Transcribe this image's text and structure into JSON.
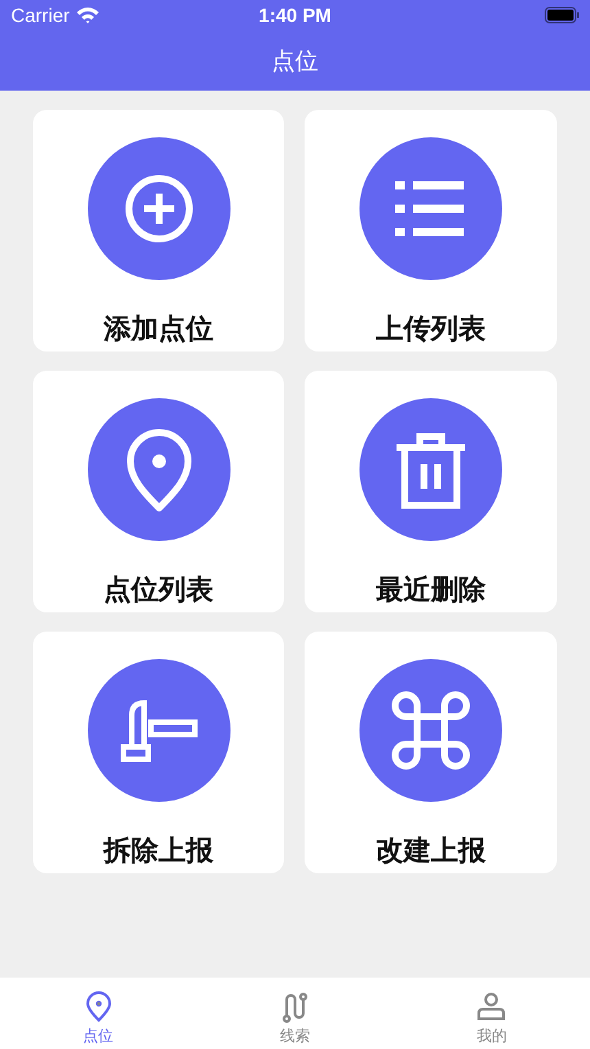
{
  "status_bar": {
    "carrier": "Carrier",
    "time": "1:40 PM"
  },
  "nav_bar": {
    "title": "点位"
  },
  "tiles": [
    {
      "label": "添加点位"
    },
    {
      "label": "上传列表"
    },
    {
      "label": "点位列表"
    },
    {
      "label": "最近删除"
    },
    {
      "label": "拆除上报"
    },
    {
      "label": "改建上报"
    }
  ],
  "tab_bar": [
    {
      "label": "点位",
      "selected": true
    },
    {
      "label": "线索",
      "selected": false
    },
    {
      "label": "我的",
      "selected": false
    }
  ]
}
